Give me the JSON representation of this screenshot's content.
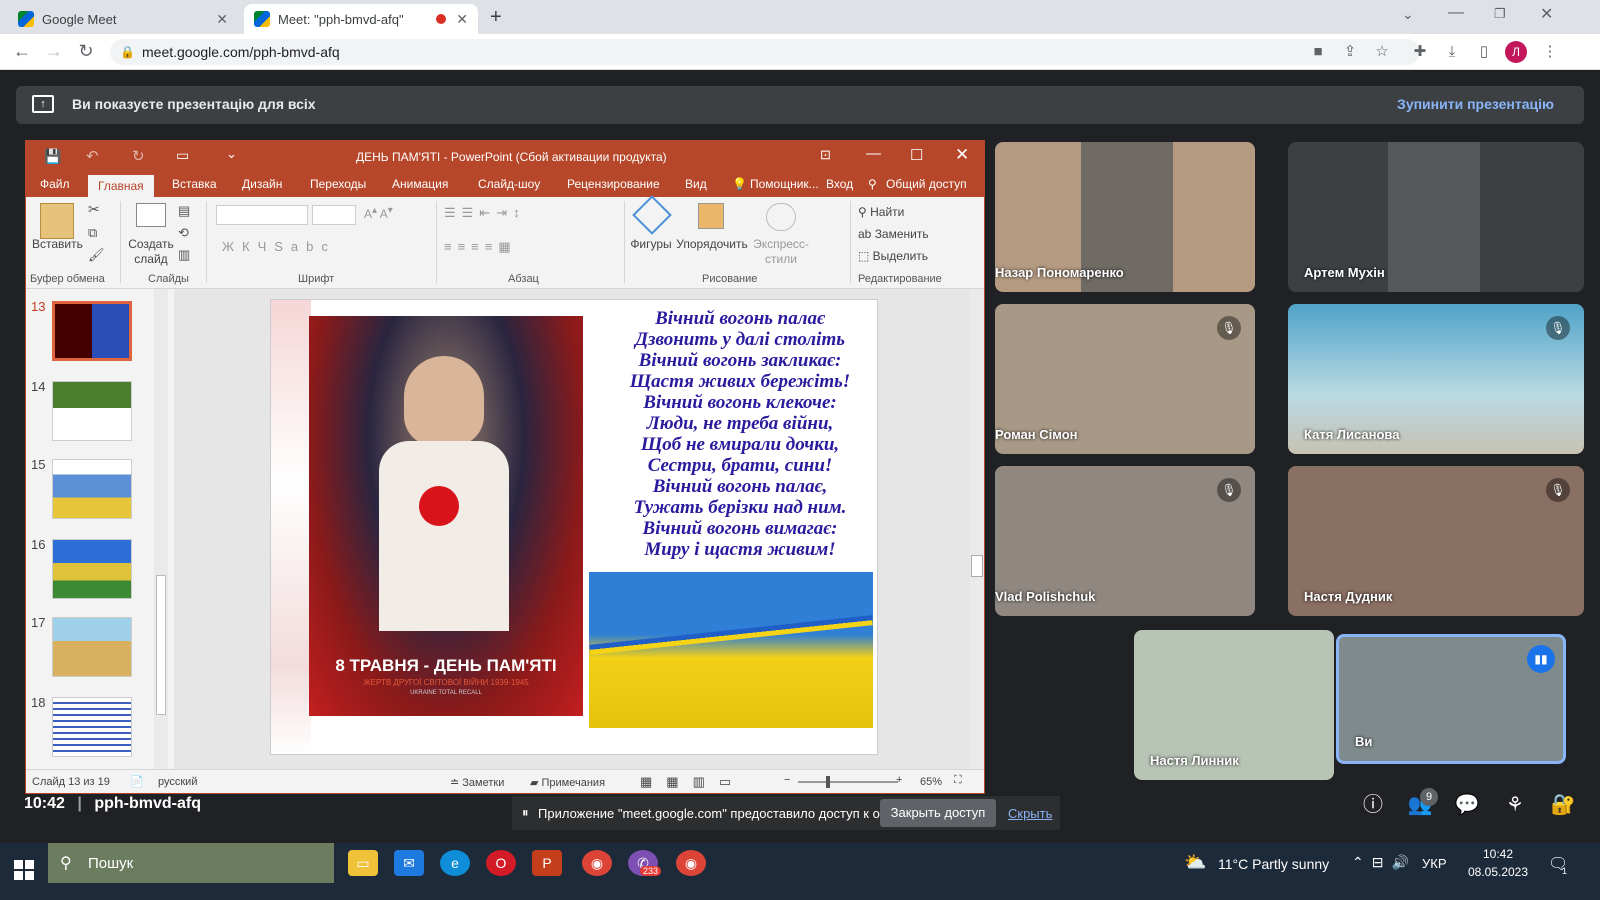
{
  "browser": {
    "tabs": [
      {
        "label": "Google Meet",
        "active": false
      },
      {
        "label": "Meet: \"pph-bmvd-afq\"",
        "active": true
      }
    ],
    "new_tab": "+",
    "url": "meet.google.com/pph-bmvd-afq",
    "profile_initial": "Л"
  },
  "banner": {
    "text": "Ви показуєте презентацію для всіх",
    "stop": "Зупинити презентацію"
  },
  "powerpoint": {
    "title": "ДЕНЬ ПАМ'ЯТІ - PowerPoint (Сбой активации продукта)",
    "tabs": [
      "Файл",
      "Главная",
      "Вставка",
      "Дизайн",
      "Переходы",
      "Анимация",
      "Слайд-шоу",
      "Рецензирование",
      "Вид"
    ],
    "helper": "Помощник...",
    "signin": "Вход",
    "share": "Общий доступ",
    "ribbon": {
      "paste": "Вставить",
      "new_slide": "Создать слайд",
      "shapes": "Фигуры",
      "arrange": "Упорядочить",
      "express": "Экспресс-стили",
      "find": "Найти",
      "replace": "Заменить",
      "select": "Выделить",
      "groups": [
        "Буфер обмена",
        "Слайды",
        "Шрифт",
        "Абзац",
        "Рисование",
        "Редактирование"
      ]
    },
    "thumbnails": [
      "13",
      "14",
      "15",
      "16",
      "17",
      "18"
    ],
    "slide": {
      "poem": [
        "Вічний вогонь палає",
        "Дзвонить у далі століть",
        "Вічний вогонь закликає:",
        "Щастя живих бережіть!",
        "Вічний вогонь клекоче:",
        "Люди, не треба війни,",
        "Щоб не вмирали дочки,",
        "Сестри, брати, сини!",
        "Вічний вогонь палає,",
        "Тужать берізки над ним.",
        "Вічний вогонь вимагає:",
        "Миру і щастя живим!"
      ],
      "poster_title": "8 ТРАВНЯ - ДЕНЬ ПАМ'ЯТІ",
      "poster_sub": "ЖЕРТВ ДРУГОЇ СВІТОВОЇ ВІЙНИ 1939-1945",
      "poster_credit": "UKRAINE TOTAL RECALL"
    },
    "status": {
      "slide": "Слайд 13 из 19",
      "lang": "русский",
      "notes": "Заметки",
      "comments": "Примечания",
      "zoom": "65%"
    }
  },
  "participants": [
    {
      "name": "Назар Пономаренко",
      "muted": false
    },
    {
      "name": "Артем Мухін",
      "muted": false
    },
    {
      "name": "Роман Сімон",
      "muted": true
    },
    {
      "name": "Катя Лисанова",
      "muted": true
    },
    {
      "name": "Vlad Polishchuk",
      "muted": true
    },
    {
      "name": "Настя Дудник",
      "muted": true
    },
    {
      "name": "Настя Линник",
      "muted": false
    },
    {
      "name": "Ви",
      "muted": false
    }
  ],
  "meeting": {
    "time": "10:42",
    "code": "pph-bmvd-afq",
    "people_count": "9"
  },
  "share_notice": {
    "text": "Приложение \"meet.google.com\" предоставило доступ к окну.",
    "close": "Закрыть доступ",
    "hide": "Скрыть"
  },
  "taskbar": {
    "search": "Пошук",
    "badge": "233",
    "weather": "11°C  Partly sunny",
    "lang": "УКР",
    "time": "10:42",
    "date": "08.05.2023",
    "notifications": "1"
  }
}
